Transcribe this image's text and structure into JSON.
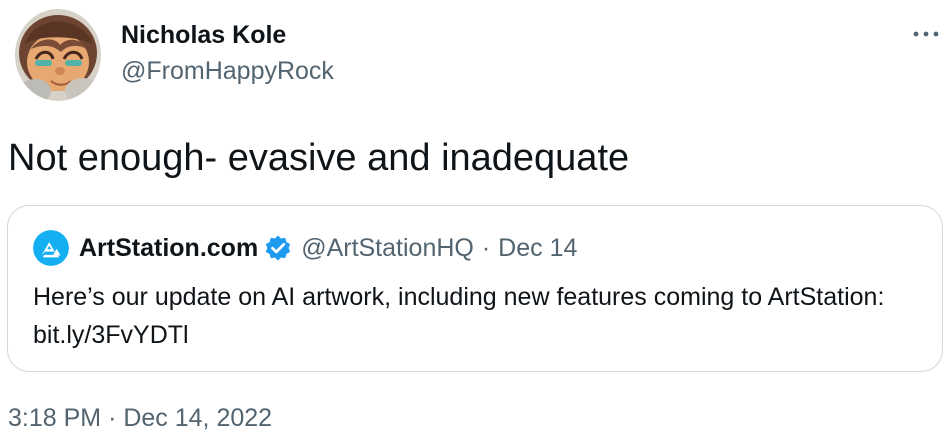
{
  "author": {
    "display_name": "Nicholas Kole",
    "handle": "@FromHappyRock",
    "avatar_icon": "cartoon-avatar-icon"
  },
  "more_icon": "more-horizontal-icon",
  "tweet": {
    "text": "Not enough- evasive and inadequate",
    "time": "3:18 PM",
    "separator": "·",
    "date": "Dec 14, 2022"
  },
  "quote": {
    "display_name": "ArtStation.com",
    "handle": "@ArtStationHQ",
    "separator": "·",
    "date": "Dec 14",
    "verified_icon": "verified-badge-icon",
    "logo_icon": "artstation-logo-icon",
    "text": "Here’s our update on AI artwork, including new features coming to ArtStation: bit.ly/3FvYDTl"
  },
  "colors": {
    "text_primary": "#0f1419",
    "text_secondary": "#536471",
    "border": "#cfd9de",
    "verified": "#1d9bf0"
  }
}
